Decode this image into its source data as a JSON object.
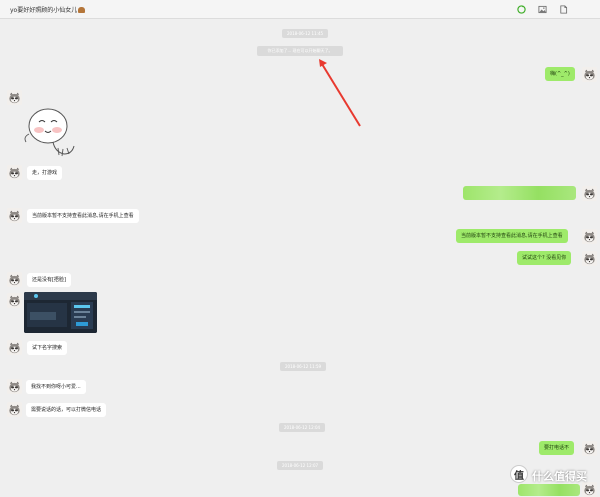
{
  "header": {
    "title": "yo要好好照顾的小仙女儿",
    "icons": [
      "refresh-icon",
      "image-icon",
      "file-icon"
    ]
  },
  "messages": {
    "time_1": "2018-06-12 11:45",
    "notice": "你已添加了... 现在可以开始聊天了。",
    "out_1": "嗨(^_^)",
    "in_1": "走，打游戏",
    "in_2": "当前版本暂不支持查看此消息,请在手机上查看",
    "out_2": "当前版本暂不支持查看此消息,请在手机上查看",
    "out_3": "试试这个? 没看见你",
    "in_3": "还是没有[捂脸]",
    "in_4": "试下名字搜索",
    "time_2": "2018-06-12 11:59",
    "in_5": "我找不到你呀小可爱...",
    "in_6": "需要说话的话，可以打微信电话",
    "time_3": "2018-06-12 12:04",
    "out_4": "要打电话不",
    "time_4": "2018-06-12 12:07"
  },
  "watermark": {
    "line1": "值",
    "line2": "什么值得买"
  },
  "colors": {
    "bubble_out": "#9eea6a",
    "bubble_in": "#ffffff",
    "background": "#efefef",
    "arrow": "#e8392f"
  }
}
